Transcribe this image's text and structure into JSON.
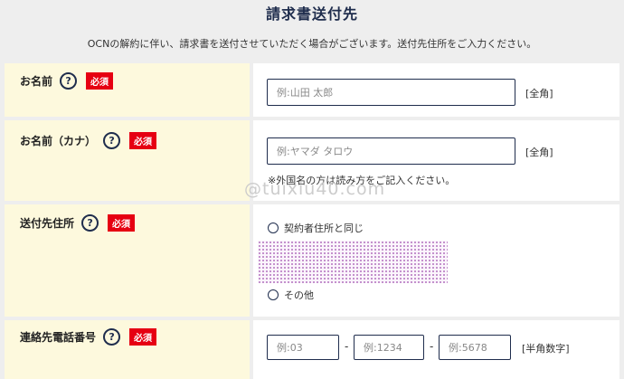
{
  "page": {
    "title": "請求書送付先",
    "intro": "OCNの解約に伴い、請求書を送付させていただく場合がございます。送付先住所をご入力ください。"
  },
  "required_label": "必須",
  "help_glyph": "?",
  "fields": {
    "name": {
      "label": "お名前",
      "placeholder": "例:山田 太郎",
      "unit": "[全角]"
    },
    "name_kana": {
      "label": "お名前（カナ）",
      "placeholder": "例:ヤマダ タロウ",
      "unit": "[全角]",
      "note": "※外国名の方は読み方をご記入ください。"
    },
    "address": {
      "label": "送付先住所",
      "options": [
        "契約者住所と同じ",
        "その他"
      ]
    },
    "phone": {
      "label": "連絡先電話番号",
      "placeholders": [
        "例:03",
        "例:1234",
        "例:5678"
      ],
      "separator": "-",
      "unit": "[半角数字]"
    }
  },
  "watermark": "@tuixiu40.com",
  "colors": {
    "label_bg": "#fdf9dd",
    "required_bg": "#e60012",
    "border": "#1f2d4d",
    "page_bg": "#eeeeee"
  }
}
